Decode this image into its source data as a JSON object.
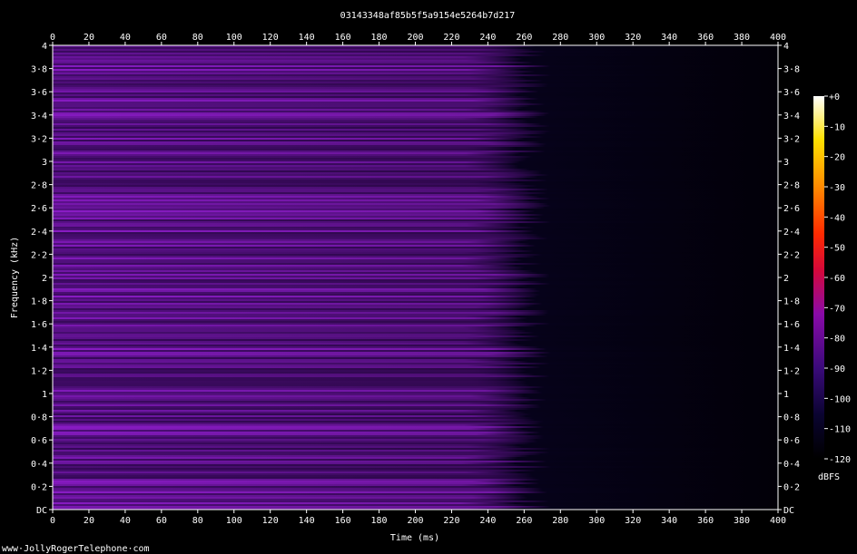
{
  "chart_data": {
    "type": "heatmap",
    "title": "03143348af85b5f5a9154e5264b7d217",
    "xlabel": "Time (ms)",
    "ylabel": "Frequency (kHz)",
    "xlim": [
      0,
      400
    ],
    "ylim": [
      0,
      4
    ],
    "x_ticks": [
      "0",
      "20",
      "40",
      "60",
      "80",
      "100",
      "120",
      "140",
      "160",
      "180",
      "200",
      "220",
      "240",
      "260",
      "280",
      "300",
      "320",
      "340",
      "360",
      "380",
      "400"
    ],
    "y_ticks": [
      "DC",
      "0·2",
      "0·4",
      "0·6",
      "0·8",
      "1",
      "1·2",
      "1·4",
      "1·6",
      "1·8",
      "2",
      "2·2",
      "2·4",
      "2·6",
      "2·8",
      "3",
      "3·2",
      "3·4",
      "3·6",
      "3·8",
      "4"
    ],
    "colorbar": {
      "label": "dBFS",
      "ticks": [
        "+0",
        "-10",
        "-20",
        "-30",
        "-40",
        "-50",
        "-60",
        "-70",
        "-80",
        "-90",
        "-100",
        "-110",
        "-120"
      ],
      "range": [
        -120,
        0
      ]
    },
    "signal": {
      "active_until_ms": 265,
      "level_dbfs": -92,
      "silence_level_dbfs": -118
    }
  },
  "footer": {
    "credit": "www·JollyRogerTelephone·com"
  },
  "colors": {
    "background": "#000000",
    "text": "#ffffff"
  }
}
